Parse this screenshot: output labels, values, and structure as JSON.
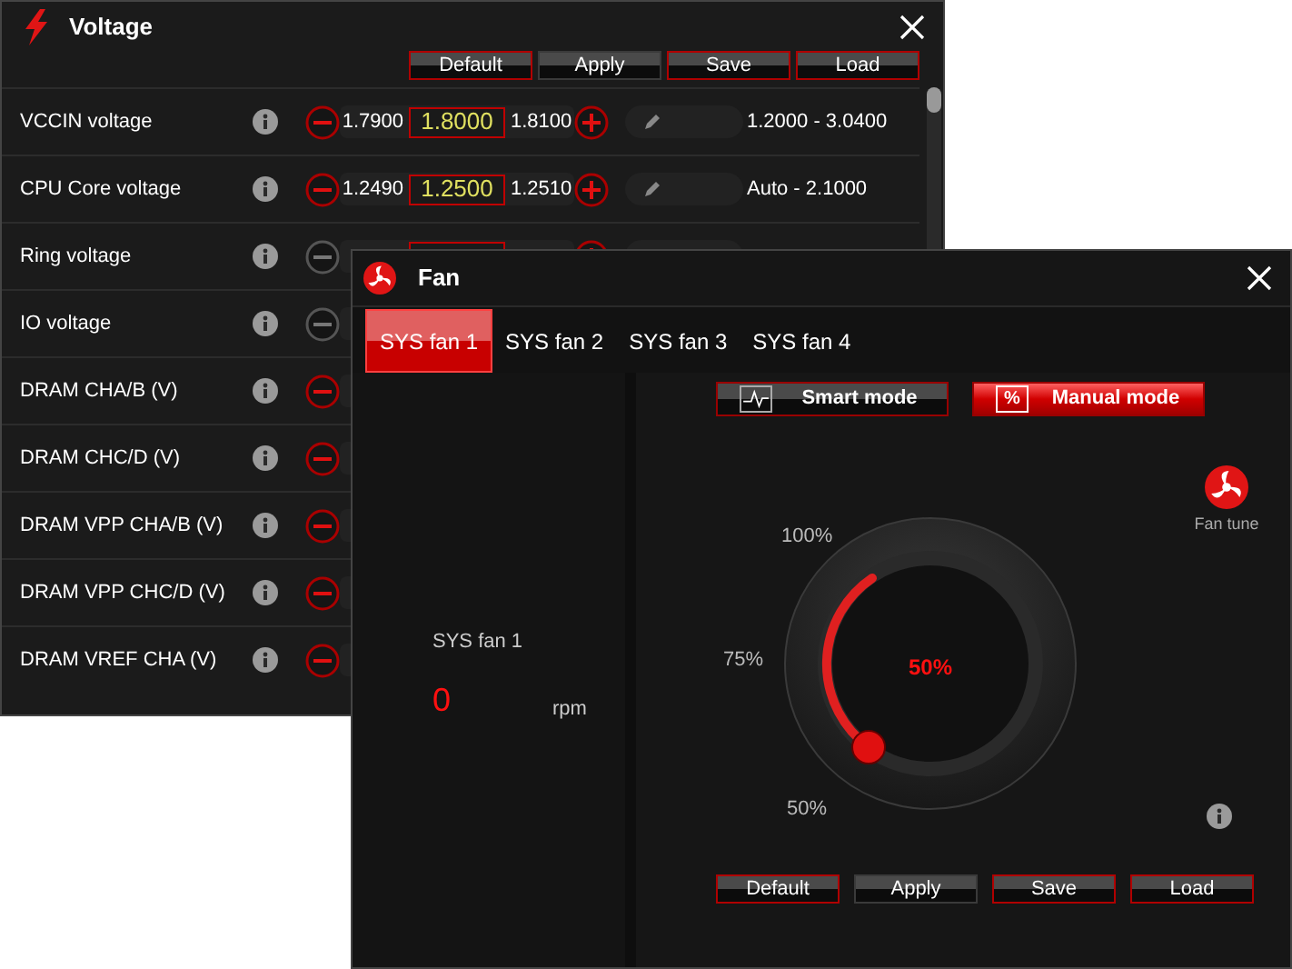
{
  "voltage_window": {
    "title": "Voltage",
    "buttons": [
      {
        "label": "Default",
        "highlighted": true
      },
      {
        "label": "Apply",
        "highlighted": false
      },
      {
        "label": "Save",
        "highlighted": true
      },
      {
        "label": "Load",
        "highlighted": true
      }
    ],
    "rows": [
      {
        "label": "VCCIN voltage",
        "disabled": false,
        "low": "1.7900",
        "value": "1.8000",
        "high": "1.8100",
        "range": "1.2000 - 3.0400"
      },
      {
        "label": "CPU Core voltage",
        "disabled": false,
        "low": "1.2490",
        "value": "1.2500",
        "high": "1.2510",
        "range": "Auto - 2.1000"
      },
      {
        "label": "Ring voltage",
        "disabled": true
      },
      {
        "label": "IO voltage",
        "disabled": true
      },
      {
        "label": "DRAM CHA/B (V)",
        "disabled": false
      },
      {
        "label": "DRAM CHC/D (V)",
        "disabled": false
      },
      {
        "label": "DRAM VPP CHA/B (V)",
        "disabled": false
      },
      {
        "label": "DRAM VPP CHC/D (V)",
        "disabled": false
      },
      {
        "label": "DRAM VREF CHA (V)",
        "disabled": false
      }
    ]
  },
  "fan_window": {
    "title": "Fan",
    "tabs": [
      {
        "label": "SYS fan 1",
        "selected": true
      },
      {
        "label": "SYS fan 2",
        "selected": false
      },
      {
        "label": "SYS fan 3",
        "selected": false
      },
      {
        "label": "SYS fan 4",
        "selected": false
      }
    ],
    "modes": [
      {
        "kind": "curve",
        "label": "Smart mode",
        "selected": false
      },
      {
        "kind": "percent",
        "symbol": "%",
        "label": "Manual mode",
        "selected": true
      }
    ],
    "fan_name": "SYS fan 1",
    "speed": "0",
    "unit": "rpm",
    "dial": {
      "ticks": [
        "100%",
        "75%",
        "50%"
      ],
      "value": "50%"
    },
    "fan_tune": "Fan tune",
    "buttons": [
      {
        "label": "Default",
        "highlighted": true
      },
      {
        "label": "Apply",
        "highlighted": false
      },
      {
        "label": "Save",
        "highlighted": true
      },
      {
        "label": "Load",
        "highlighted": true
      }
    ]
  }
}
